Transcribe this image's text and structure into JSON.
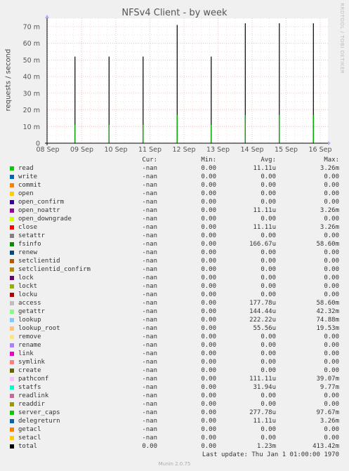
{
  "title": "NFSv4 Client - by week",
  "side_label": "RRDTOOL / TOBI OETIKER",
  "chart_data": {
    "type": "bar",
    "title": "NFSv4 Client - by week",
    "ylabel": "requests / second",
    "ylim": [
      0,
      75
    ],
    "yticks": [
      {
        "value": 0,
        "label": "0"
      },
      {
        "value": 10,
        "label": "10 m"
      },
      {
        "value": 20,
        "label": "20 m"
      },
      {
        "value": 30,
        "label": "30 m"
      },
      {
        "value": 40,
        "label": "40 m"
      },
      {
        "value": 50,
        "label": "50 m"
      },
      {
        "value": 60,
        "label": "60 m"
      },
      {
        "value": 70,
        "label": "70 m"
      }
    ],
    "xticks": [
      "08 Sep",
      "09 Sep",
      "10 Sep",
      "11 Sep",
      "12 Sep",
      "13 Sep",
      "14 Sep",
      "15 Sep",
      "16 Sep"
    ],
    "spikes": [
      {
        "day": 0.8,
        "total": 52,
        "green": 11
      },
      {
        "day": 1.8,
        "total": 52,
        "green": 11
      },
      {
        "day": 2.8,
        "total": 52,
        "green": 11
      },
      {
        "day": 3.8,
        "total": 71,
        "green": 17
      },
      {
        "day": 4.8,
        "total": 52,
        "green": 11
      },
      {
        "day": 5.8,
        "total": 72,
        "green": 17
      },
      {
        "day": 6.8,
        "total": 72,
        "green": 17
      },
      {
        "day": 7.8,
        "total": 72,
        "green": 17
      }
    ],
    "grid": true
  },
  "legend": {
    "headers": {
      "cur": "Cur:",
      "min": "Min:",
      "avg": "Avg:",
      "max": "Max:"
    },
    "rows": [
      {
        "name": "read",
        "color": "#00cc00",
        "cur": "-nan",
        "min": "0.00",
        "avg": "11.11u",
        "max": "3.26m"
      },
      {
        "name": "write",
        "color": "#0066b3",
        "cur": "-nan",
        "min": "0.00",
        "avg": "0.00",
        "max": "0.00"
      },
      {
        "name": "commit",
        "color": "#ff8000",
        "cur": "-nan",
        "min": "0.00",
        "avg": "0.00",
        "max": "0.00"
      },
      {
        "name": "open",
        "color": "#ffcc00",
        "cur": "-nan",
        "min": "0.00",
        "avg": "0.00",
        "max": "0.00"
      },
      {
        "name": "open_confirm",
        "color": "#330099",
        "cur": "-nan",
        "min": "0.00",
        "avg": "0.00",
        "max": "0.00"
      },
      {
        "name": "open_noattr",
        "color": "#990099",
        "cur": "-nan",
        "min": "0.00",
        "avg": "11.11u",
        "max": "3.26m"
      },
      {
        "name": "open_downgrade",
        "color": "#ccff00",
        "cur": "-nan",
        "min": "0.00",
        "avg": "0.00",
        "max": "0.00"
      },
      {
        "name": "close",
        "color": "#ff0000",
        "cur": "-nan",
        "min": "0.00",
        "avg": "11.11u",
        "max": "3.26m"
      },
      {
        "name": "setattr",
        "color": "#808080",
        "cur": "-nan",
        "min": "0.00",
        "avg": "0.00",
        "max": "0.00"
      },
      {
        "name": "fsinfo",
        "color": "#008f00",
        "cur": "-nan",
        "min": "0.00",
        "avg": "166.67u",
        "max": "58.60m"
      },
      {
        "name": "renew",
        "color": "#00487d",
        "cur": "-nan",
        "min": "0.00",
        "avg": "0.00",
        "max": "0.00"
      },
      {
        "name": "setclientid",
        "color": "#b35a00",
        "cur": "-nan",
        "min": "0.00",
        "avg": "0.00",
        "max": "0.00"
      },
      {
        "name": "setclientid_confirm",
        "color": "#b38f00",
        "cur": "-nan",
        "min": "0.00",
        "avg": "0.00",
        "max": "0.00"
      },
      {
        "name": "lock",
        "color": "#6b006b",
        "cur": "-nan",
        "min": "0.00",
        "avg": "0.00",
        "max": "0.00"
      },
      {
        "name": "lockt",
        "color": "#8fb300",
        "cur": "-nan",
        "min": "0.00",
        "avg": "0.00",
        "max": "0.00"
      },
      {
        "name": "locku",
        "color": "#b30000",
        "cur": "-nan",
        "min": "0.00",
        "avg": "0.00",
        "max": "0.00"
      },
      {
        "name": "access",
        "color": "#bebebe",
        "cur": "-nan",
        "min": "0.00",
        "avg": "177.78u",
        "max": "58.60m"
      },
      {
        "name": "getattr",
        "color": "#80ff80",
        "cur": "-nan",
        "min": "0.00",
        "avg": "144.44u",
        "max": "42.32m"
      },
      {
        "name": "lookup",
        "color": "#80c9ff",
        "cur": "-nan",
        "min": "0.00",
        "avg": "222.22u",
        "max": "74.88m"
      },
      {
        "name": "lookup_root",
        "color": "#ffc080",
        "cur": "-nan",
        "min": "0.00",
        "avg": "55.56u",
        "max": "19.53m"
      },
      {
        "name": "remove",
        "color": "#ffe680",
        "cur": "-nan",
        "min": "0.00",
        "avg": "0.00",
        "max": "0.00"
      },
      {
        "name": "rename",
        "color": "#aa80ff",
        "cur": "-nan",
        "min": "0.00",
        "avg": "0.00",
        "max": "0.00"
      },
      {
        "name": "link",
        "color": "#ee00cc",
        "cur": "-nan",
        "min": "0.00",
        "avg": "0.00",
        "max": "0.00"
      },
      {
        "name": "symlink",
        "color": "#ff8080",
        "cur": "-nan",
        "min": "0.00",
        "avg": "0.00",
        "max": "0.00"
      },
      {
        "name": "create",
        "color": "#666600",
        "cur": "-nan",
        "min": "0.00",
        "avg": "0.00",
        "max": "0.00"
      },
      {
        "name": "pathconf",
        "color": "#ffbfff",
        "cur": "-nan",
        "min": "0.00",
        "avg": "111.11u",
        "max": "39.07m"
      },
      {
        "name": "statfs",
        "color": "#00ffcc",
        "cur": "-nan",
        "min": "0.00",
        "avg": "31.94u",
        "max": "9.77m"
      },
      {
        "name": "readlink",
        "color": "#cc6699",
        "cur": "-nan",
        "min": "0.00",
        "avg": "0.00",
        "max": "0.00"
      },
      {
        "name": "readdir",
        "color": "#999900",
        "cur": "-nan",
        "min": "0.00",
        "avg": "0.00",
        "max": "0.00"
      },
      {
        "name": "server_caps",
        "color": "#00cc00",
        "cur": "-nan",
        "min": "0.00",
        "avg": "277.78u",
        "max": "97.67m"
      },
      {
        "name": "delegreturn",
        "color": "#0066b3",
        "cur": "-nan",
        "min": "0.00",
        "avg": "11.11u",
        "max": "3.26m"
      },
      {
        "name": "getacl",
        "color": "#ff8000",
        "cur": "-nan",
        "min": "0.00",
        "avg": "0.00",
        "max": "0.00"
      },
      {
        "name": "setacl",
        "color": "#ffcc00",
        "cur": "-nan",
        "min": "0.00",
        "avg": "0.00",
        "max": "0.00"
      },
      {
        "name": "total",
        "color": "#000000",
        "cur": "0.00",
        "min": "0.00",
        "avg": "1.23m",
        "max": "413.42m"
      }
    ]
  },
  "last_update": "Last update: Thu Jan  1 01:00:00 1970",
  "footer": "Munin 2.0.75"
}
